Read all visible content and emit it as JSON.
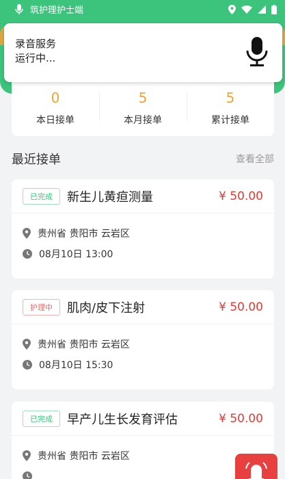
{
  "status_bar": {
    "app_name": "筑护理护士端"
  },
  "notification": {
    "line1": "录音服务",
    "line2": "运行中..."
  },
  "stats": [
    {
      "value": "0",
      "label": "本日接单"
    },
    {
      "value": "5",
      "label": "本月接单"
    },
    {
      "value": "5",
      "label": "累计接单"
    }
  ],
  "recent": {
    "title": "最近接单",
    "view_all": "查看全部"
  },
  "orders": [
    {
      "status": "已完成",
      "service": "新生儿黄疸测量",
      "price": "¥ 50.00",
      "location": "贵州省 贵阳市 云岩区",
      "time": "08月10日 13:00"
    },
    {
      "status": "护理中",
      "service": "肌肉/皮下注射",
      "price": "¥ 50.00",
      "location": "贵州省 贵阳市 云岩区",
      "time": "08月10日 15:30"
    },
    {
      "status": "已完成",
      "service": "早产儿生长发育评估",
      "price": "¥ 50.00",
      "location": "贵州省 贵阳市 云岩区",
      "time": ""
    }
  ],
  "colors": {
    "brand_green": "#3cc47c",
    "accent_orange": "#f0a330",
    "price_red": "#e53935"
  }
}
